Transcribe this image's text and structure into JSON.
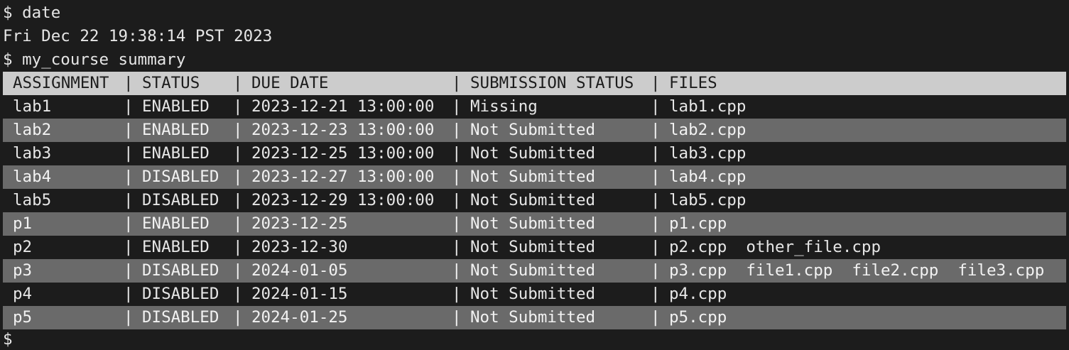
{
  "session": {
    "prompt_symbol": "$",
    "commands": [
      {
        "prompt": "$",
        "command": "date",
        "output": "Fri Dec 22 19:38:14 PST 2023"
      },
      {
        "prompt": "$",
        "command": "my_course summary"
      }
    ],
    "final_prompt": "$"
  },
  "table": {
    "separator": "|",
    "headers": [
      "ASSIGNMENT",
      "STATUS",
      "DUE DATE",
      "SUBMISSION STATUS",
      "FILES"
    ],
    "rows": [
      {
        "assignment": "lab1",
        "status": "ENABLED",
        "due": "2023-12-21 13:00:00",
        "submission": "Missing",
        "files": "lab1.cpp"
      },
      {
        "assignment": "lab2",
        "status": "ENABLED",
        "due": "2023-12-23 13:00:00",
        "submission": "Not Submitted",
        "files": "lab2.cpp"
      },
      {
        "assignment": "lab3",
        "status": "ENABLED",
        "due": "2023-12-25 13:00:00",
        "submission": "Not Submitted",
        "files": "lab3.cpp"
      },
      {
        "assignment": "lab4",
        "status": "DISABLED",
        "due": "2023-12-27 13:00:00",
        "submission": "Not Submitted",
        "files": "lab4.cpp"
      },
      {
        "assignment": "lab5",
        "status": "DISABLED",
        "due": "2023-12-29 13:00:00",
        "submission": "Not Submitted",
        "files": "lab5.cpp"
      },
      {
        "assignment": "p1",
        "status": "ENABLED",
        "due": "2023-12-25",
        "submission": "Not Submitted",
        "files": "p1.cpp"
      },
      {
        "assignment": "p2",
        "status": "ENABLED",
        "due": "2023-12-30",
        "submission": "Not Submitted",
        "files": "p2.cpp  other_file.cpp"
      },
      {
        "assignment": "p3",
        "status": "DISABLED",
        "due": "2024-01-05",
        "submission": "Not Submitted",
        "files": "p3.cpp  file1.cpp  file2.cpp  file3.cpp"
      },
      {
        "assignment": "p4",
        "status": "DISABLED",
        "due": "2024-01-15",
        "submission": "Not Submitted",
        "files": "p4.cpp"
      },
      {
        "assignment": "p5",
        "status": "DISABLED",
        "due": "2024-01-25",
        "submission": "Not Submitted",
        "files": "p5.cpp"
      }
    ]
  },
  "colors": {
    "background": "#1c1c1c",
    "foreground": "#e6e6e6",
    "header_background": "#cccccc",
    "alt_row_background": "#6a6a6a"
  }
}
